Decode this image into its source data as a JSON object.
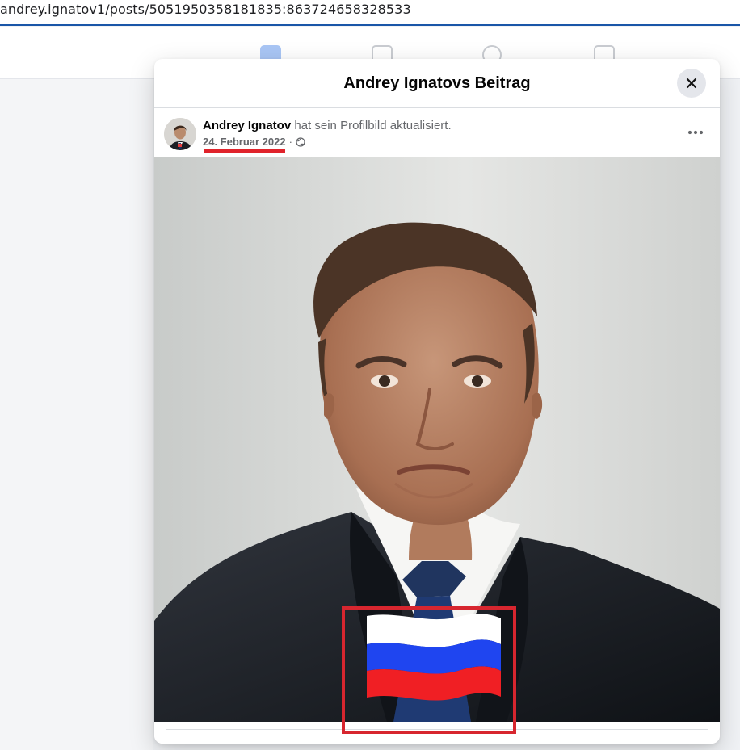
{
  "browser": {
    "address": "andrey.ignatov1/posts/5051950358181835:863724658328533"
  },
  "navigation": {
    "icons": [
      "home-icon",
      "video-icon",
      "groups-icon",
      "gaming-icon"
    ]
  },
  "modal": {
    "title": "Andrey Ignatovs Beitrag",
    "close_icon": "close-icon"
  },
  "post": {
    "author": "Andrey Ignatov",
    "action": "hat sein Profilbild aktualisiert.",
    "date": "24. Februar 2022",
    "separator": "·",
    "audience_icon": "globe-icon",
    "more_icon": "more-options-icon"
  },
  "photo": {
    "subject": "profile-photo",
    "flag": {
      "name": "russia-flag-icon",
      "stripes": [
        "#ffffff",
        "#1f45f0",
        "#f01f24"
      ]
    }
  },
  "annotations": {
    "date_marker_color": "#e0232b",
    "highlight_color": "#d7262f"
  }
}
